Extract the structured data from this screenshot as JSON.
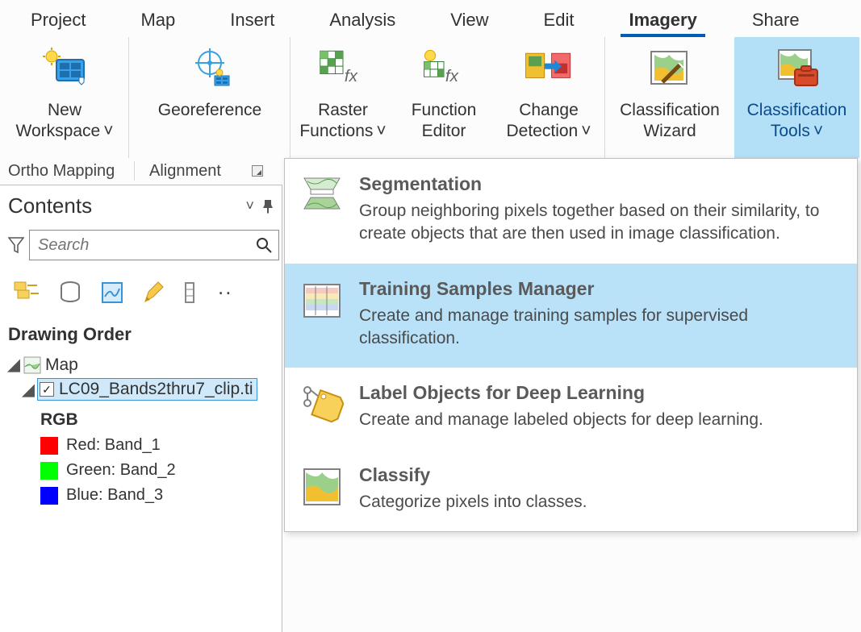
{
  "tabs": {
    "project": "Project",
    "map": "Map",
    "insert": "Insert",
    "analysis": "Analysis",
    "view": "View",
    "edit": "Edit",
    "imagery": "Imagery",
    "share": "Share"
  },
  "ribbon": {
    "new_workspace": "New\nWorkspace",
    "georeference": "Georeference",
    "raster_functions": "Raster\nFunctions",
    "function_editor": "Function\nEditor",
    "change_detection": "Change\nDetection",
    "classification_wizard": "Classification\nWizard",
    "classification_tools": "Classification\nTools"
  },
  "group_labels": {
    "ortho_mapping": "Ortho Mapping",
    "alignment": "Alignment"
  },
  "contents": {
    "title": "Contents",
    "search_placeholder": "Search",
    "section": "Drawing Order",
    "map_label": "Map",
    "layer_name": "LC09_Bands2thru7_clip.ti",
    "rgb_label": "RGB",
    "bands": {
      "red": "Red:   Band_1",
      "green": "Green: Band_2",
      "blue": "Blue:   Band_3"
    }
  },
  "dropdown": {
    "segmentation": {
      "title": "Segmentation",
      "desc": "Group neighboring pixels together based on their similarity, to create objects that are then used in image classification."
    },
    "training_samples": {
      "title": "Training Samples Manager",
      "desc": "Create and manage training samples for supervised classification."
    },
    "label_objects": {
      "title": "Label Objects for Deep Learning",
      "desc": "Create and manage labeled objects for deep learning."
    },
    "classify": {
      "title": "Classify",
      "desc": "Categorize pixels into classes."
    }
  }
}
